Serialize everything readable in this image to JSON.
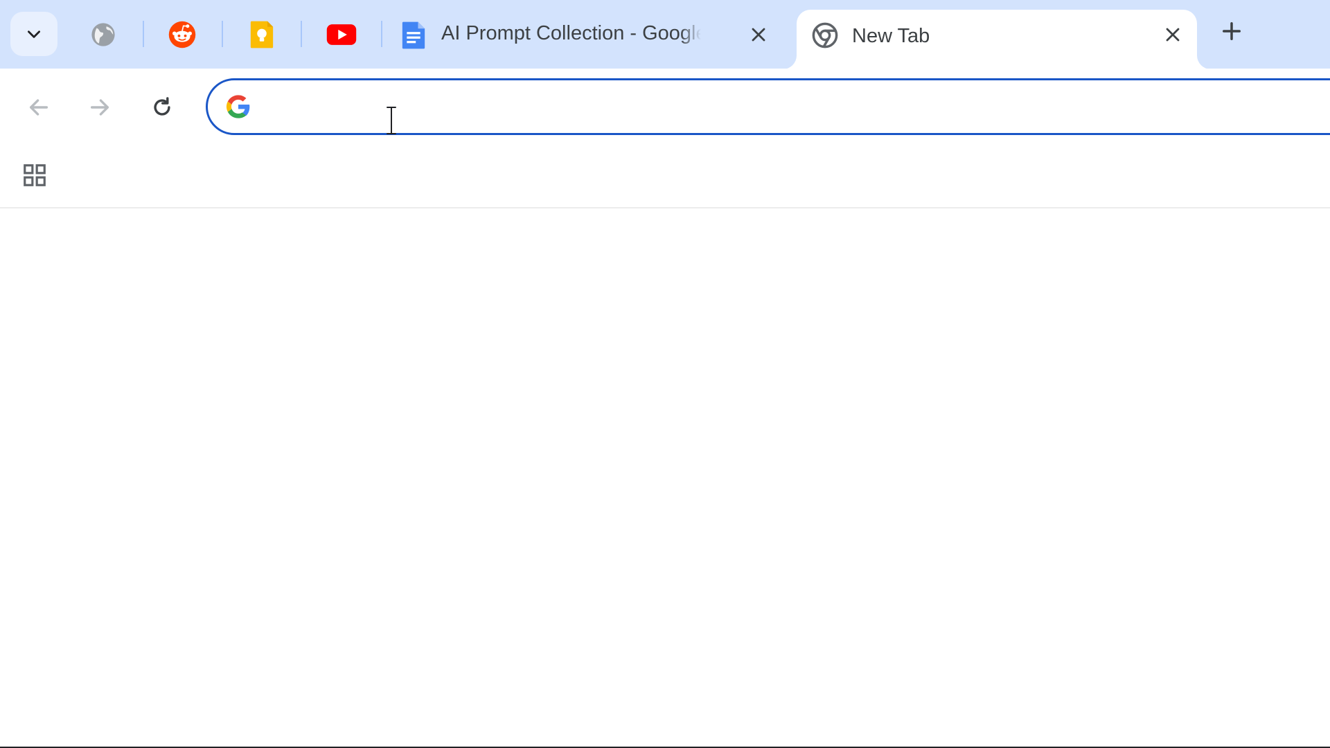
{
  "browser": {
    "accent_color": "#1a56c7",
    "tabstrip_color": "#d3e3fd"
  },
  "tabs": {
    "search_icon": "chevron-down-icon",
    "pinned": [
      {
        "icon": "globe-icon",
        "site": "globe"
      },
      {
        "icon": "reddit-icon",
        "site": "reddit"
      },
      {
        "icon": "keep-icon",
        "site": "google-keep"
      },
      {
        "icon": "youtube-icon",
        "site": "youtube"
      }
    ],
    "docs_tab": {
      "title": "AI Prompt Collection - Google Docs",
      "icon": "google-docs-icon"
    },
    "active_tab": {
      "title": "New Tab",
      "icon": "chrome-icon"
    },
    "new_tab_icon": "plus-icon"
  },
  "toolbar": {
    "back_icon": "arrow-left-icon",
    "forward_icon": "arrow-right-icon",
    "reload_icon": "reload-icon",
    "omnibox": {
      "value": "",
      "engine_icon": "google-g-icon"
    }
  },
  "bookmarks": {
    "apps_icon": "apps-grid-icon"
  }
}
